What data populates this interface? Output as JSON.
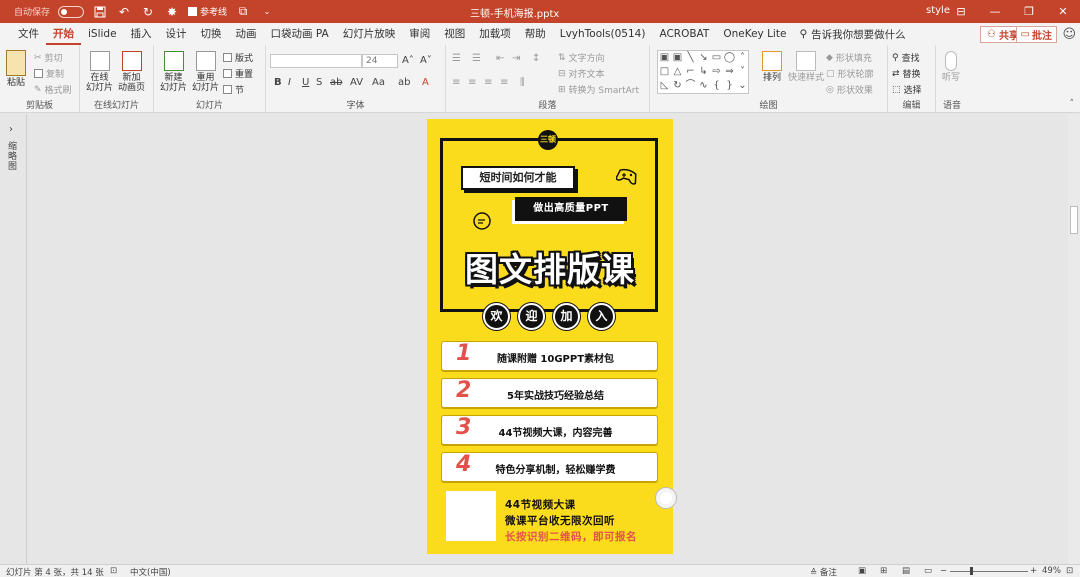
{
  "titlebar": {
    "autosave_label": "自动保存",
    "autosave_state": "关",
    "ref_lines_label": "参考线",
    "doc_title": "三顿-手机海报.pptx",
    "user": "style"
  },
  "menu": {
    "tabs": [
      "文件",
      "开始",
      "iSlide",
      "插入",
      "设计",
      "切换",
      "动画",
      "口袋动画 PA",
      "幻灯片放映",
      "审阅",
      "视图",
      "加载项",
      "帮助",
      "LvyhTools(0514)",
      "ACROBAT",
      "OneKey Lite"
    ],
    "active_tab": "开始",
    "tell_me": "告诉我你想要做什么",
    "share": "共享",
    "comment": "批注"
  },
  "ribbon": {
    "clipboard": {
      "paste": "粘贴",
      "cut": "剪切",
      "copy": "复制",
      "format_painter": "格式刷",
      "label": "剪贴板"
    },
    "online_slides": {
      "online": "在线\n幻灯片",
      "new_anim": "新加\n动画页",
      "label": "在线幻灯片"
    },
    "slides": {
      "new_slide": "新建\n幻灯片",
      "reuse": "重用\n幻灯片",
      "layout": "版式",
      "reset": "重置",
      "section": "节",
      "label": "幻灯片"
    },
    "font": {
      "size": "24",
      "label": "字体"
    },
    "paragraph": {
      "text_dir": "文字方向",
      "align_text": "对齐文本",
      "smartart": "转换为 SmartArt",
      "label": "段落"
    },
    "drawing": {
      "arrange": "排列",
      "quick_styles": "快速样式",
      "shape_fill": "形状填充",
      "shape_outline": "形状轮廓",
      "shape_effects": "形状效果",
      "label": "绘图"
    },
    "editing": {
      "find": "查找",
      "replace": "替换",
      "select": "选择",
      "label": "编辑"
    },
    "voice": {
      "dictate": "听写",
      "label": "语音"
    }
  },
  "thumb_label": "缩略图",
  "slide": {
    "logo": "三顿",
    "subtitle1": "短时间如何才能",
    "subtitle2": "做出高质量PPT",
    "title": "图文排版课",
    "welcome": [
      "欢",
      "迎",
      "加",
      "入"
    ],
    "items": [
      {
        "num": "1",
        "text": "随课附赠 10GPPT素材包"
      },
      {
        "num": "2",
        "text": "5年实战技巧经验总结"
      },
      {
        "num": "3",
        "text": "44节视频大课，内容完善"
      },
      {
        "num": "4",
        "text": "特色分享机制，轻松赚学费"
      }
    ],
    "info1": "44节视频大课",
    "info2": "微课平台收无限次回听",
    "info3": "长按识别二维码，即可报名"
  },
  "statusbar": {
    "slide_info": "幻灯片 第 4 张，共 14 张",
    "language": "中文(中国)",
    "notes": "备注",
    "zoom": "49%"
  }
}
